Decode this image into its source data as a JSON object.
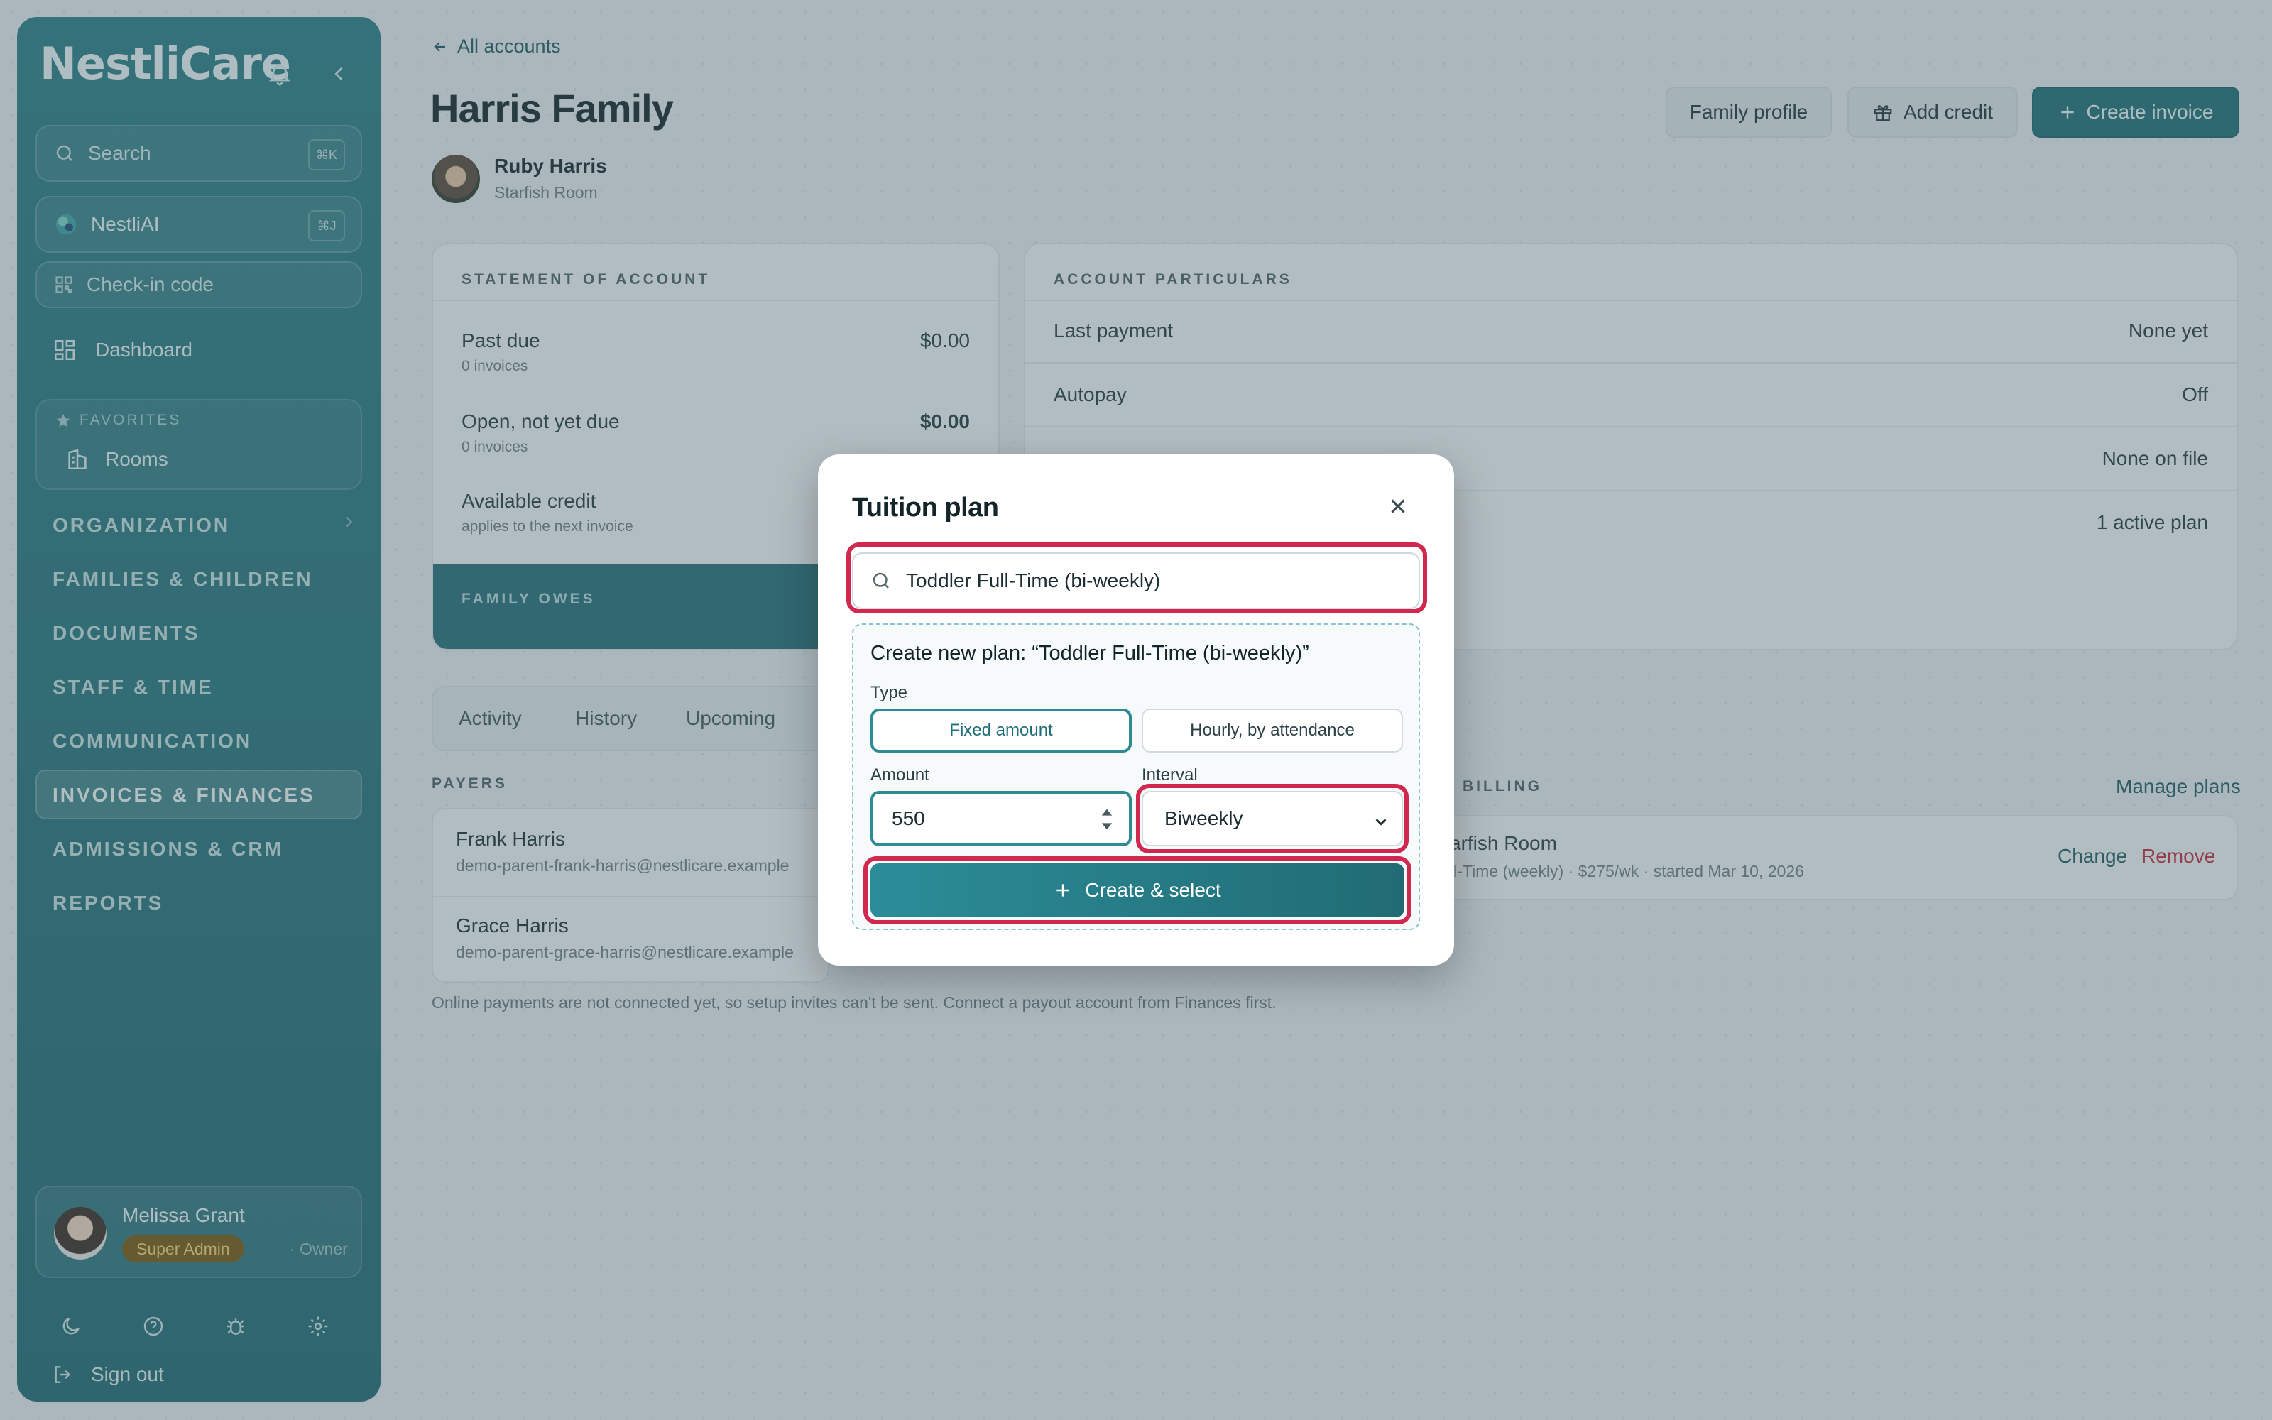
{
  "sidebar": {
    "brand": "NestliCare",
    "search_placeholder": "Search",
    "search_kbd": "⌘K",
    "ai_label": "NestliAI",
    "ai_kbd": "⌘J",
    "checkin_label": "Check-in code",
    "dashboard_label": "Dashboard",
    "favorites_label": "FAVORITES",
    "favorite_room": "Rooms",
    "sections": [
      "ORGANIZATION",
      "FAMILIES & CHILDREN",
      "DOCUMENTS",
      "STAFF & TIME",
      "COMMUNICATION",
      "INVOICES & FINANCES",
      "ADMISSIONS & CRM",
      "REPORTS"
    ],
    "active_section": "INVOICES & FINANCES",
    "user": {
      "name": "Melissa Grant",
      "role": "Super Admin",
      "title": "· Owner"
    },
    "signout_label": "Sign out"
  },
  "header": {
    "back_label": "All accounts",
    "title": "Harris Family",
    "child_name": "Ruby Harris",
    "child_room": "Starfish Room",
    "buttons": {
      "family_profile": "Family profile",
      "add_credit": "Add credit",
      "create_invoice": "Create invoice"
    }
  },
  "statement": {
    "title": "STATEMENT OF ACCOUNT",
    "rows": [
      {
        "label": "Past due",
        "sub": "0 invoices",
        "value": "$0.00"
      },
      {
        "label": "Open, not yet due",
        "sub": "0 invoices",
        "value": "$0.00"
      },
      {
        "label": "Available credit",
        "sub": "applies to the next invoice",
        "value": ""
      }
    ],
    "owes_label": "FAMILY OWES"
  },
  "particulars": {
    "title": "ACCOUNT PARTICULARS",
    "rows": [
      {
        "label": "Last payment",
        "value": "None yet"
      },
      {
        "label": "Autopay",
        "value": "Off"
      },
      {
        "label": "",
        "value": "None on file"
      },
      {
        "label": "",
        "value": "1 active plan"
      }
    ]
  },
  "tabs": [
    "Activity",
    "History",
    "Upcoming"
  ],
  "payers": {
    "title": "PAYERS",
    "items": [
      {
        "name": "Frank Harris",
        "email": "demo-parent-frank-harris@nestlicare.example"
      },
      {
        "name": "Grace Harris",
        "email": "demo-parent-grace-harris@nestlicare.example"
      }
    ],
    "note": "Online payments are not connected yet, so setup invites can't be sent. Connect a payout account from Finances first."
  },
  "billing": {
    "title": "BILLING",
    "manage_label": "Manage plans",
    "room": "arfish Room",
    "detail": "ll-Time (weekly) · $275/wk · started Mar 10, 2026",
    "change_label": "Change",
    "remove_label": "Remove"
  },
  "modal": {
    "title": "Tuition plan",
    "search_value": "Toddler Full-Time (bi-weekly)",
    "new_plan_title": "Create new plan: “Toddler Full-Time (bi-weekly)”",
    "type_label": "Type",
    "type_options": [
      "Fixed amount",
      "Hourly, by attendance"
    ],
    "amount_label": "Amount",
    "amount_value": "550",
    "interval_label": "Interval",
    "interval_value": "Biweekly",
    "create_label": "Create & select"
  },
  "colors": {
    "accent": "#1f6e78",
    "highlight": "#d0284e",
    "remove": "#c0283d"
  }
}
